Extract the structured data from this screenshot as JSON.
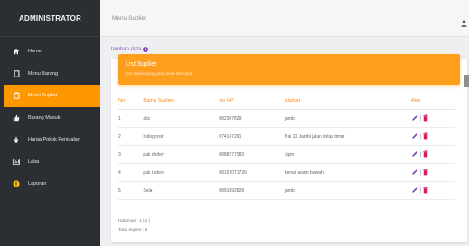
{
  "sidebar": {
    "brand": "ADMINISTRATOR",
    "items": [
      {
        "label": "Home",
        "icon": "home-icon"
      },
      {
        "label": "Menu Barang",
        "icon": "box-icon"
      },
      {
        "label": "Menu Suplier",
        "icon": "clipboard-icon"
      },
      {
        "label": "Barang Masuk",
        "icon": "thumb-up-icon"
      },
      {
        "label": "Harga Pokok Penjualan",
        "icon": "tag-icon"
      },
      {
        "label": "Laba",
        "icon": "chart-icon"
      },
      {
        "label": "Laporan",
        "icon": "report-icon"
      }
    ],
    "active_index": 2
  },
  "topbar": {
    "title": "Menu Suplier"
  },
  "main": {
    "add_link": "tambah data",
    "card": {
      "title": "List Suplier",
      "subtitle": "List suplier yang yang telah ditempati"
    },
    "table": {
      "headers": [
        "No",
        "Nama Suplier",
        "No HP",
        "Alamat",
        "Aksi"
      ],
      "rows": [
        {
          "no": "1",
          "name": "abc",
          "hp": "082307829",
          "address": "jambi"
        },
        {
          "no": "2",
          "name": "Indogrosir",
          "hp": "074167261",
          "address": "Pal 10 Jambi jalan lintas timur"
        },
        {
          "no": "3",
          "name": "pak deden",
          "hp": "0888277383",
          "address": "sipin"
        },
        {
          "no": "4",
          "name": "pak raden",
          "hp": "08152071726",
          "address": "kenali asam bawah"
        },
        {
          "no": "5",
          "name": "Sela",
          "hp": "0891892828",
          "address": "jambi"
        }
      ]
    },
    "pagination": "Halaman : 1 | 2 |",
    "total": "Total suplier : 6"
  },
  "colors": {
    "accent": "#ff9800",
    "sidebar_bg": "#2b2f33",
    "edit": "#7a3fb0",
    "delete": "#d81b60"
  }
}
